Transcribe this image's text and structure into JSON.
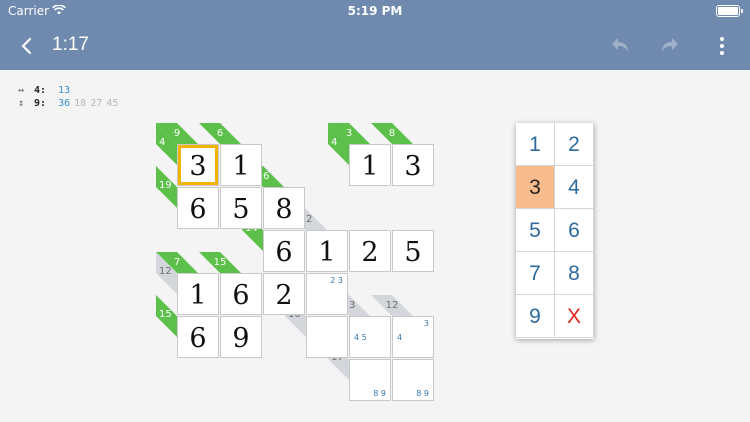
{
  "status_bar": {
    "carrier": "Carrier",
    "time": "5:19 PM"
  },
  "nav": {
    "title": "1:17"
  },
  "hints": {
    "horizontal": {
      "sum": "4:",
      "combos": [
        {
          "text": "13",
          "active": true
        }
      ]
    },
    "vertical": {
      "sum": "9:",
      "combos": [
        {
          "text": "36",
          "active": true
        },
        {
          "text": "18",
          "active": false
        },
        {
          "text": "27",
          "active": false
        },
        {
          "text": "45",
          "active": false
        }
      ]
    }
  },
  "colors": {
    "nav": "#6f8aae",
    "clue_solved": "#5cc04a",
    "clue_open": "#d3d7db",
    "selected": "#f2b400",
    "keypad_highlight": "#f7bb8c",
    "erase": "#e3231b"
  },
  "board": {
    "selected": [
      0,
      0
    ],
    "cells": [
      {
        "r": 0,
        "c": 0,
        "v": "3"
      },
      {
        "r": 0,
        "c": 1,
        "v": "1"
      },
      {
        "r": 1,
        "c": 0,
        "v": "6"
      },
      {
        "r": 1,
        "c": 1,
        "v": "5"
      },
      {
        "r": 1,
        "c": 2,
        "v": "8"
      },
      {
        "r": 0,
        "c": 4,
        "v": "1"
      },
      {
        "r": 0,
        "c": 5,
        "v": "3"
      },
      {
        "r": 2,
        "c": 2,
        "v": "6"
      },
      {
        "r": 2,
        "c": 3,
        "v": "1"
      },
      {
        "r": 2,
        "c": 4,
        "v": "2"
      },
      {
        "r": 2,
        "c": 5,
        "v": "5"
      },
      {
        "r": 3,
        "c": 0,
        "v": "1"
      },
      {
        "r": 3,
        "c": 1,
        "v": "6"
      },
      {
        "r": 3,
        "c": 2,
        "v": "2"
      },
      {
        "r": 3,
        "c": 3,
        "v": "",
        "notes": [
          "2",
          "3"
        ],
        "pos": "tr"
      },
      {
        "r": 4,
        "c": 0,
        "v": "6"
      },
      {
        "r": 4,
        "c": 1,
        "v": "9"
      },
      {
        "r": 4,
        "c": 3,
        "v": ""
      },
      {
        "r": 4,
        "c": 4,
        "v": "",
        "notes": [
          "4",
          "5"
        ],
        "pos": "ml"
      },
      {
        "r": 4,
        "c": 5,
        "v": "",
        "notes": [
          "4",
          "3"
        ],
        "pos": "ml_tr"
      },
      {
        "r": 5,
        "c": 4,
        "v": "",
        "notes": [
          "8",
          "9"
        ],
        "pos": "br"
      },
      {
        "r": 5,
        "c": 5,
        "v": "",
        "notes": [
          "8",
          "9"
        ],
        "pos": "br"
      }
    ],
    "clues_top": [
      {
        "r": 0,
        "c": 0,
        "sum": "9",
        "solved": true
      },
      {
        "r": 0,
        "c": 1,
        "sum": "6",
        "solved": true
      },
      {
        "r": 1,
        "c": 2,
        "sum": "16",
        "solved": true
      },
      {
        "r": 0,
        "c": 4,
        "sum": "3",
        "solved": true
      },
      {
        "r": 0,
        "c": 5,
        "sum": "8",
        "solved": true
      },
      {
        "r": 2,
        "c": 3,
        "sum": "12",
        "solved": false
      },
      {
        "r": 3,
        "c": 0,
        "sum": "7",
        "solved": true
      },
      {
        "r": 3,
        "c": 1,
        "sum": "15",
        "solved": true
      },
      {
        "r": 4,
        "c": 4,
        "sum": "13",
        "solved": false
      },
      {
        "r": 4,
        "c": 5,
        "sum": "12",
        "solved": false
      }
    ],
    "clues_left": [
      {
        "r": 0,
        "c": 0,
        "sum": "4",
        "solved": true
      },
      {
        "r": 1,
        "c": 0,
        "sum": "19",
        "solved": true
      },
      {
        "r": 0,
        "c": 4,
        "sum": "4",
        "solved": true
      },
      {
        "r": 2,
        "c": 2,
        "sum": "14",
        "solved": true
      },
      {
        "r": 3,
        "c": 0,
        "sum": "12",
        "solved": false
      },
      {
        "r": 4,
        "c": 0,
        "sum": "15",
        "solved": true
      },
      {
        "r": 4,
        "c": 3,
        "sum": "16",
        "solved": false
      },
      {
        "r": 5,
        "c": 4,
        "sum": "17",
        "solved": false
      }
    ]
  },
  "keypad": {
    "highlight": "3",
    "keys": [
      "1",
      "2",
      "3",
      "4",
      "5",
      "6",
      "7",
      "8",
      "9",
      "X"
    ]
  }
}
